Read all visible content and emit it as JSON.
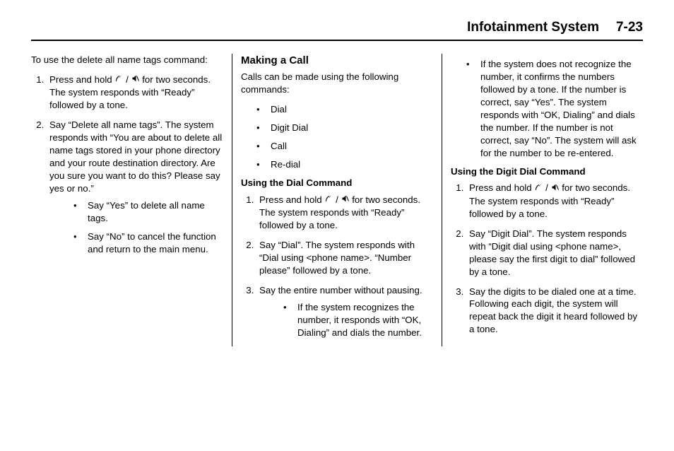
{
  "header": {
    "title": "Infotainment System",
    "page": "7-23"
  },
  "col1": {
    "intro": "To use the delete all name tags command:",
    "step1_pre": "Press and hold ",
    "step1_post": " for two seconds. The system responds with “Ready” followed by a tone.",
    "step2": "Say “Delete all name tags”. The system responds with “You are about to delete all name tags stored in your phone directory and your route destination directory. Are you sure you want to do this? Please say yes or no.”",
    "sub1": "Say “Yes” to delete all name tags.",
    "sub2": "Say “No” to cancel the function and return to the main menu."
  },
  "col2": {
    "h2": "Making a Call",
    "intro": "Calls can be made using the following commands:",
    "cmds": {
      "a": "Dial",
      "b": "Digit Dial",
      "c": "Call",
      "d": "Re-dial"
    },
    "h3": "Using the Dial Command",
    "step1_pre": "Press and hold ",
    "step1_post": " for two seconds. The system responds with “Ready” followed by a tone.",
    "step2": "Say “Dial”. The system responds with “Dial using <phone name>. “Number please” followed by a tone.",
    "step3": "Say the entire number without pausing.",
    "step3_sub": "If the system recognizes the number, it responds with “OK, Dialing” and dials the number."
  },
  "col3": {
    "top_bullet": "If the system does not recognize the number, it confirms the numbers followed by a tone. If the number is correct, say “Yes”. The system responds with “OK, Dialing” and dials the number. If the number is not correct, say “No”. The system will ask for the number to be re-entered.",
    "h3": "Using the Digit Dial Command",
    "step1_pre": "Press and hold ",
    "step1_post": " for two seconds. The system responds with “Ready” followed by a tone.",
    "step2": "Say “Digit Dial”. The system responds with “Digit dial using <phone name>, please say the first digit to dial” followed by a tone.",
    "step3": "Say the digits to be dialed one at a time. Following each digit, the system will repeat back the digit it heard followed by a tone."
  },
  "icons": {
    "slash": " / "
  }
}
